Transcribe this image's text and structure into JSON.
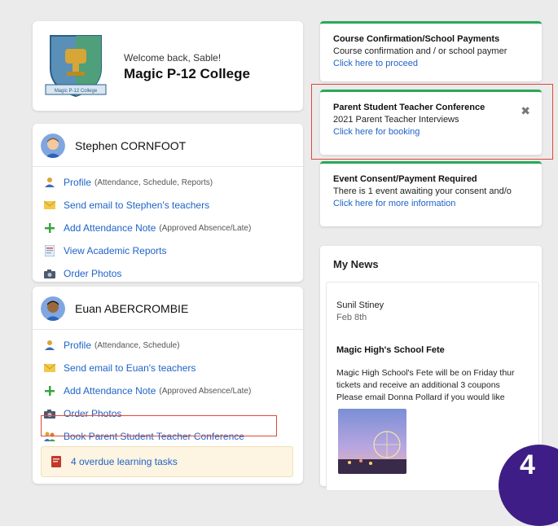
{
  "school": {
    "welcome": "Welcome back, Sable!",
    "name": "Magic P-12 College",
    "crest_banner": "Magic P-12 College"
  },
  "students": [
    {
      "name": "Stephen CORNFOOT",
      "menu": [
        {
          "label": "Profile",
          "sub": "(Attendance, Schedule, Reports)",
          "icon": "profile-icon"
        },
        {
          "label": "Send email to Stephen's teachers",
          "sub": "",
          "icon": "email-icon"
        },
        {
          "label": "Add Attendance Note",
          "sub": "(Approved Absence/Late)",
          "icon": "plus-icon"
        },
        {
          "label": "View Academic Reports",
          "sub": "",
          "icon": "report-icon"
        },
        {
          "label": "Order Photos",
          "sub": "",
          "icon": "camera-icon"
        }
      ]
    },
    {
      "name": "Euan ABERCROMBIE",
      "menu": [
        {
          "label": "Profile",
          "sub": "(Attendance, Schedule)",
          "icon": "profile-icon"
        },
        {
          "label": "Send email to Euan's teachers",
          "sub": "",
          "icon": "email-icon"
        },
        {
          "label": "Add Attendance Note",
          "sub": "(Approved Absence/Late)",
          "icon": "plus-icon"
        },
        {
          "label": "Order Photos",
          "sub": "",
          "icon": "camera-icon"
        },
        {
          "label": "Book Parent Student Teacher Conference",
          "sub": "",
          "icon": "conference-icon"
        }
      ],
      "overdue": "4 overdue learning tasks"
    }
  ],
  "notifications": [
    {
      "title": "Course Confirmation/School Payments",
      "body": "Course confirmation and / or school paymer",
      "link": "Click here to proceed"
    },
    {
      "title": "Parent Student Teacher Conference",
      "body": "2021 Parent Teacher Interviews",
      "link": "Click here for booking"
    },
    {
      "title": "Event Consent/Payment Required",
      "body": "There is 1 event awaiting your consent and/o",
      "link": "Click here for more information"
    }
  ],
  "news": {
    "header": "My News",
    "author": "Sunil Stiney",
    "date": "Feb 8th",
    "title": "Magic High's School Fete",
    "body_lines": [
      "Magic High School's Fete will be on Friday thur",
      "tickets and receive an additional 3 coupons",
      "Please email Donna Pollard if you would like"
    ]
  },
  "badge": "4",
  "colors": {
    "accent_green": "#2aa957",
    "link_blue": "#1f63c8",
    "highlight_red": "#e0473a",
    "badge_purple": "#3f1d86"
  }
}
